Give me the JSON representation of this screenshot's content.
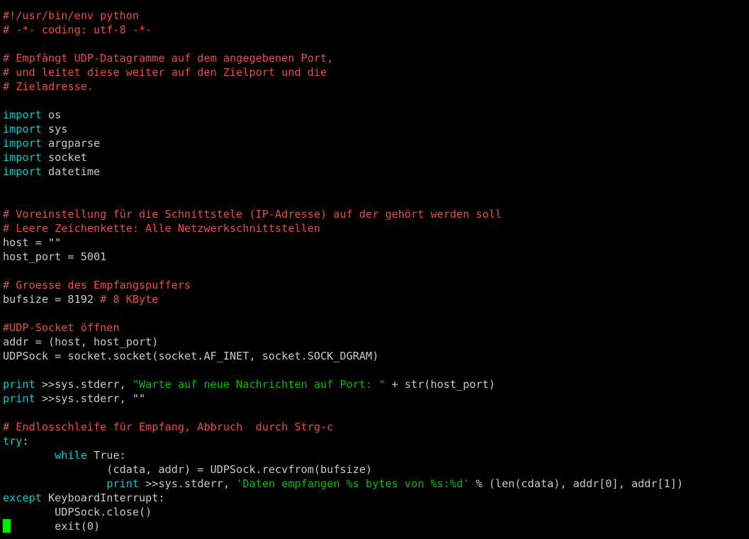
{
  "editor": {
    "app": "terminal-text-editor",
    "background_color": "#000000",
    "language": "python",
    "colors": {
      "comment": "#e84b4b",
      "keyword": "#00cdcd",
      "string": "#00c000",
      "plain": "#c8c8c8",
      "cursor": "#00ef00",
      "background": "#000000"
    },
    "cursor": {
      "line": 36,
      "column": 0,
      "shape": "block"
    }
  },
  "code_lines": [
    {
      "n": 1,
      "tokens": [
        {
          "t": "comment",
          "v": "#!/usr/bin/env python"
        }
      ]
    },
    {
      "n": 2,
      "tokens": [
        {
          "t": "comment",
          "v": "# -*- coding: utf-8 -*-"
        }
      ]
    },
    {
      "n": 3,
      "tokens": []
    },
    {
      "n": 4,
      "tokens": [
        {
          "t": "comment",
          "v": "# Empfängt UDP-Datagramme auf dem angegebenen Port,"
        }
      ]
    },
    {
      "n": 5,
      "tokens": [
        {
          "t": "comment",
          "v": "# und leitet diese weiter auf den Zielport und die"
        }
      ]
    },
    {
      "n": 6,
      "tokens": [
        {
          "t": "comment",
          "v": "# Zieladresse."
        }
      ]
    },
    {
      "n": 7,
      "tokens": []
    },
    {
      "n": 8,
      "tokens": [
        {
          "t": "keyword",
          "v": "import"
        },
        {
          "t": "plain",
          "v": " os"
        }
      ]
    },
    {
      "n": 9,
      "tokens": [
        {
          "t": "keyword",
          "v": "import"
        },
        {
          "t": "plain",
          "v": " sys"
        }
      ]
    },
    {
      "n": 10,
      "tokens": [
        {
          "t": "keyword",
          "v": "import"
        },
        {
          "t": "plain",
          "v": " argparse"
        }
      ]
    },
    {
      "n": 11,
      "tokens": [
        {
          "t": "keyword",
          "v": "import"
        },
        {
          "t": "plain",
          "v": " socket"
        }
      ]
    },
    {
      "n": 12,
      "tokens": [
        {
          "t": "keyword",
          "v": "import"
        },
        {
          "t": "plain",
          "v": " datetime"
        }
      ]
    },
    {
      "n": 13,
      "tokens": []
    },
    {
      "n": 14,
      "tokens": []
    },
    {
      "n": 15,
      "tokens": [
        {
          "t": "comment",
          "v": "# Voreinstellung für die Schnittstele (IP-Adresse) auf der gehört werden soll"
        }
      ]
    },
    {
      "n": 16,
      "tokens": [
        {
          "t": "comment",
          "v": "# Leere Zeichenkette: Alle Netzwerkschnittstellen"
        }
      ]
    },
    {
      "n": 17,
      "tokens": [
        {
          "t": "plain",
          "v": "host = \"\""
        }
      ]
    },
    {
      "n": 18,
      "tokens": [
        {
          "t": "plain",
          "v": "host_port = 5001"
        }
      ]
    },
    {
      "n": 19,
      "tokens": []
    },
    {
      "n": 20,
      "tokens": [
        {
          "t": "comment",
          "v": "# Groesse des Empfangspuffers"
        }
      ]
    },
    {
      "n": 21,
      "tokens": [
        {
          "t": "plain",
          "v": "bufsize = 8192 "
        },
        {
          "t": "comment",
          "v": "# 8 KByte"
        }
      ]
    },
    {
      "n": 22,
      "tokens": []
    },
    {
      "n": 23,
      "tokens": [
        {
          "t": "comment",
          "v": "#UDP-Socket öffnen"
        }
      ]
    },
    {
      "n": 24,
      "tokens": [
        {
          "t": "plain",
          "v": "addr = (host, host_port)"
        }
      ]
    },
    {
      "n": 25,
      "tokens": [
        {
          "t": "plain",
          "v": "UDPSock = socket.socket(socket.AF_INET, socket.SOCK_DGRAM)"
        }
      ]
    },
    {
      "n": 26,
      "tokens": []
    },
    {
      "n": 27,
      "tokens": [
        {
          "t": "keyword",
          "v": "print"
        },
        {
          "t": "plain",
          "v": " >>sys.stderr, "
        },
        {
          "t": "string",
          "v": "\"Warte auf neue Nachrichten auf Port: \""
        },
        {
          "t": "plain",
          "v": " + str(host_port)"
        }
      ]
    },
    {
      "n": 28,
      "tokens": [
        {
          "t": "keyword",
          "v": "print"
        },
        {
          "t": "plain",
          "v": " >>sys.stderr, \"\""
        }
      ]
    },
    {
      "n": 29,
      "tokens": []
    },
    {
      "n": 30,
      "tokens": [
        {
          "t": "comment",
          "v": "# Endlosschleife für Empfang, Abbruch  durch Strg-c"
        }
      ]
    },
    {
      "n": 31,
      "tokens": [
        {
          "t": "keyword",
          "v": "try"
        },
        {
          "t": "plain",
          "v": ":"
        }
      ]
    },
    {
      "n": 32,
      "tokens": [
        {
          "t": "plain",
          "v": "        "
        },
        {
          "t": "keyword",
          "v": "while"
        },
        {
          "t": "plain",
          "v": " True:"
        }
      ]
    },
    {
      "n": 33,
      "tokens": [
        {
          "t": "plain",
          "v": "                (cdata, addr) = UDPSock.recvfrom(bufsize)"
        }
      ]
    },
    {
      "n": 34,
      "tokens": [
        {
          "t": "plain",
          "v": "                "
        },
        {
          "t": "keyword",
          "v": "print"
        },
        {
          "t": "plain",
          "v": " >>sys.stderr, "
        },
        {
          "t": "string",
          "v": "'Daten empfangen %s bytes von %s:%d'"
        },
        {
          "t": "plain",
          "v": " % (len(cdata), addr[0], addr[1])"
        }
      ]
    },
    {
      "n": 35,
      "tokens": [
        {
          "t": "keyword",
          "v": "except"
        },
        {
          "t": "plain",
          "v": " KeyboardInterrupt:"
        }
      ]
    },
    {
      "n": 36,
      "tokens": [
        {
          "t": "plain",
          "v": "        UDPSock.close()"
        }
      ]
    },
    {
      "n": 37,
      "tokens": [
        {
          "t": "plain",
          "v": "        exit(0)"
        }
      ]
    }
  ]
}
